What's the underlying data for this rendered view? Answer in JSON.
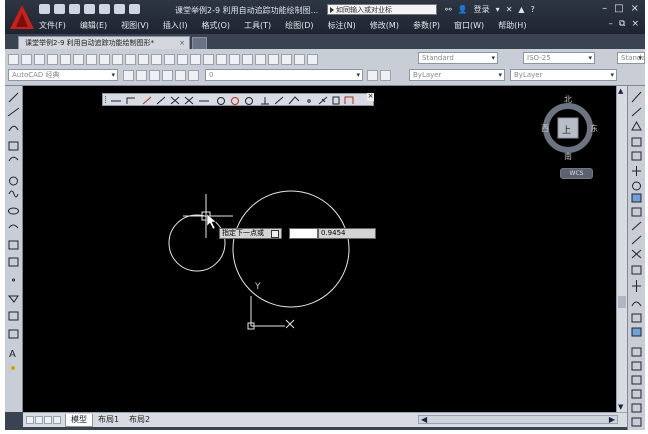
{
  "window": {
    "title": "课堂举例2-9 利用自动追踪功能绘制图...",
    "search_placeholder": "如同输入或对业标",
    "login_label": "登录",
    "menu": [
      "文件(F)",
      "编辑(E)",
      "视图(V)",
      "插入(I)",
      "格式(O)",
      "工具(T)",
      "绘图(D)",
      "标注(N)",
      "修改(M)",
      "参数(P)",
      "窗口(W)",
      "帮助(H)"
    ]
  },
  "document_tab": {
    "label": "课堂举例2-9 利用自动追踪功能绘制图形*"
  },
  "toolbar": {
    "text_style": "Standard",
    "dim_style": "ISO-25",
    "table_style": "Standa",
    "workspace": "AutoCAD 经典",
    "layer": "0",
    "color": "ByLayer",
    "linetype": "ByLayer"
  },
  "compass": {
    "north": "北",
    "south": "南",
    "west": "西",
    "east": "东",
    "top": "上",
    "wcs": "WCS"
  },
  "command_prompt": {
    "label": "指定下一点或",
    "value": "0.9454"
  },
  "ucs": {
    "y_label": "Y"
  },
  "layout_tabs": [
    "模型",
    "布局1",
    "布局2"
  ],
  "colors": {
    "canvas": "#000000",
    "accent_red": "#c8201a",
    "ui_gray": "#c9ced6"
  }
}
